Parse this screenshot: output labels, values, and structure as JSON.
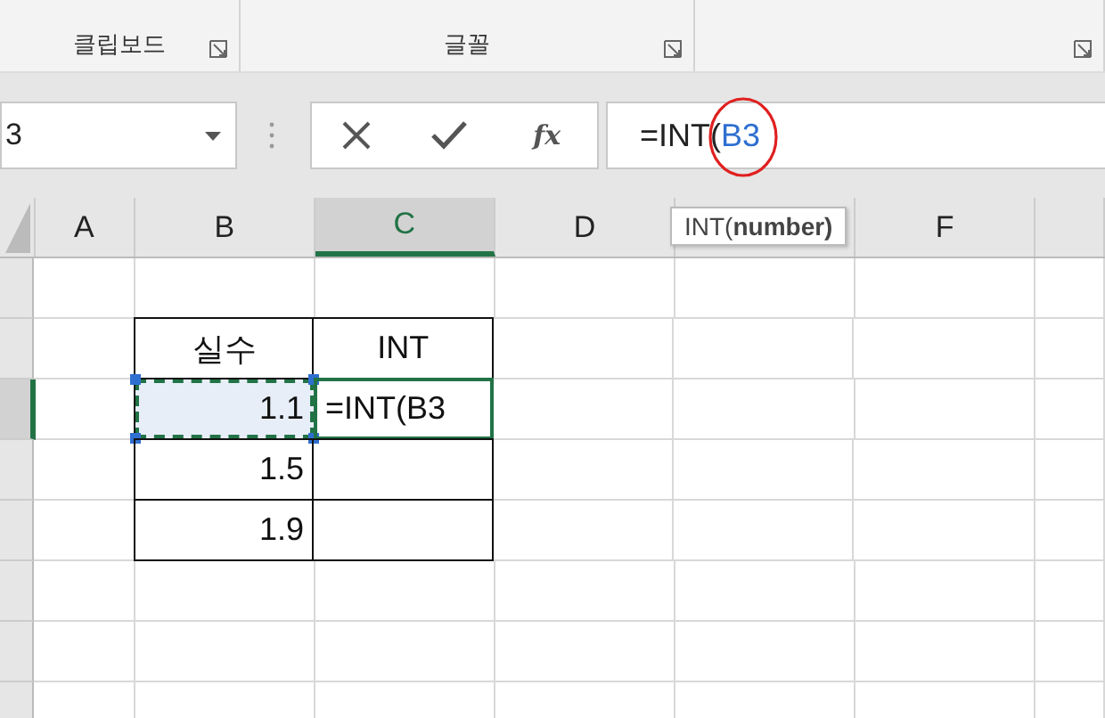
{
  "ribbon": {
    "groups": [
      {
        "label": "클립보드",
        "launcher": true
      },
      {
        "label": "글꼴",
        "launcher": true
      },
      {
        "launcher": true
      }
    ]
  },
  "name_box": {
    "value": "3"
  },
  "formula_bar": {
    "function_button": "fx",
    "parts": [
      {
        "text": "=INT(",
        "kind": "plain"
      },
      {
        "text": "B3",
        "kind": "reference"
      }
    ],
    "annotation_circle": true
  },
  "tooltip": {
    "text": "INT(**number)**"
  },
  "sheet": {
    "columns": [
      {
        "label": "A",
        "selected": false
      },
      {
        "label": "B",
        "selected": false
      },
      {
        "label": "C",
        "selected": true
      },
      {
        "label": "D",
        "selected": false
      },
      {
        "selected": false
      },
      {
        "label": "F",
        "selected": false
      },
      {
        "selected": false
      }
    ],
    "rows": [
      {
        "selected": false
      },
      {
        "selected": false,
        "b": {
          "text": "실수",
          "kind": "header"
        },
        "c": {
          "text": "INT",
          "kind": "header"
        }
      },
      {
        "selected": true,
        "b": {
          "text": "1.1",
          "kind": "number",
          "referenced": true
        },
        "c": {
          "text": "=INT(B3",
          "kind": "editing"
        }
      },
      {
        "selected": false,
        "b": {
          "text": "1.5",
          "kind": "number",
          "referenced": false
        },
        "c": {
          "kind": "number"
        }
      },
      {
        "selected": false,
        "b": {
          "text": "1.9",
          "kind": "number",
          "referenced": false
        },
        "c": {
          "kind": "number"
        }
      },
      {
        "selected": false
      },
      {
        "selected": false
      },
      {
        "selected": false
      }
    ]
  }
}
